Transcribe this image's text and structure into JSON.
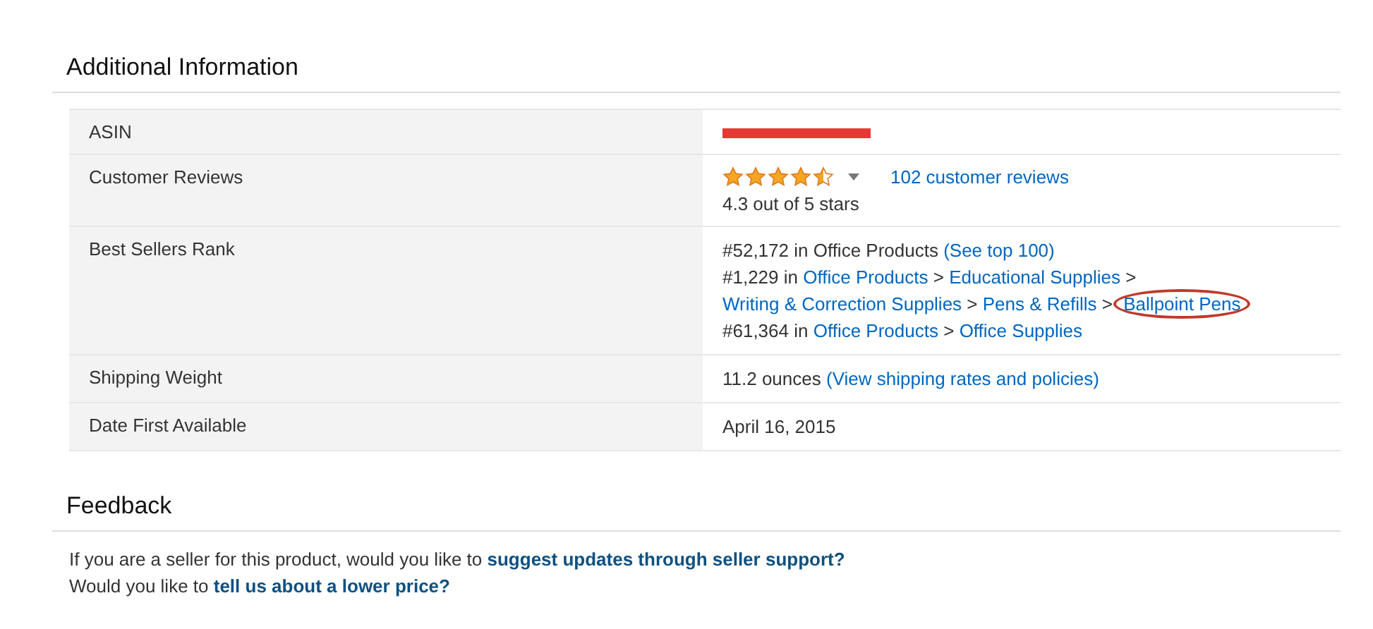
{
  "sections": [
    {
      "kind": "table",
      "title": "Additional Information",
      "rows": [
        {
          "label": "ASIN",
          "value": {
            "kind": "redacted"
          }
        },
        {
          "label": "Customer Reviews",
          "value": {
            "kind": "rating",
            "stars": 4.5,
            "reviews_link": "102 customer reviews",
            "summary": "4.3 out of 5 stars"
          }
        },
        {
          "label": "Best Sellers Rank",
          "value": {
            "kind": "lines",
            "lines": [
              [
                {
                  "text": "#52,172 in Office Products ",
                  "link": false
                },
                {
                  "text": "(See top 100)",
                  "link": true,
                  "circled": false
                }
              ],
              [
                {
                  "text": "#1,229 in ",
                  "link": false
                },
                {
                  "text": "Office Products",
                  "link": true,
                  "circled": false
                },
                {
                  "text": " > ",
                  "link": false
                },
                {
                  "text": "Educational Supplies",
                  "link": true,
                  "circled": false
                },
                {
                  "text": " > ",
                  "link": false
                },
                {
                  "text": "Writing & Correction Supplies",
                  "link": true,
                  "circled": false
                },
                {
                  "text": " > ",
                  "link": false
                },
                {
                  "text": "Pens & Refills",
                  "link": true,
                  "circled": false
                },
                {
                  "text": " > ",
                  "link": false
                },
                {
                  "text": "Ballpoint Pens",
                  "link": true,
                  "circled": true
                }
              ],
              [
                {
                  "text": "#61,364 in ",
                  "link": false
                },
                {
                  "text": "Office Products",
                  "link": true,
                  "circled": false
                },
                {
                  "text": " > ",
                  "link": false
                },
                {
                  "text": "Office Supplies",
                  "link": true,
                  "circled": false
                }
              ]
            ]
          }
        },
        {
          "label": "Shipping Weight",
          "value": {
            "kind": "lines",
            "lines": [
              [
                {
                  "text": "11.2 ounces ",
                  "link": false
                },
                {
                  "text": "(View shipping rates and policies)",
                  "link": true,
                  "circled": false
                }
              ]
            ]
          }
        },
        {
          "label": "Date First Available",
          "value": {
            "kind": "lines",
            "lines": [
              [
                {
                  "text": "April 16, 2015",
                  "link": false
                }
              ]
            ]
          }
        }
      ]
    },
    {
      "kind": "paragraphs",
      "title": "Feedback",
      "paragraphs": [
        [
          {
            "text": "If you are a seller for this product, would you like to ",
            "link": false
          },
          {
            "text": "suggest updates through seller support?",
            "link": true,
            "circled": false
          }
        ],
        [
          {
            "text": "Would you like to ",
            "link": false
          },
          {
            "text": "tell us about a lower price?",
            "link": true,
            "circled": false
          }
        ]
      ]
    }
  ]
}
